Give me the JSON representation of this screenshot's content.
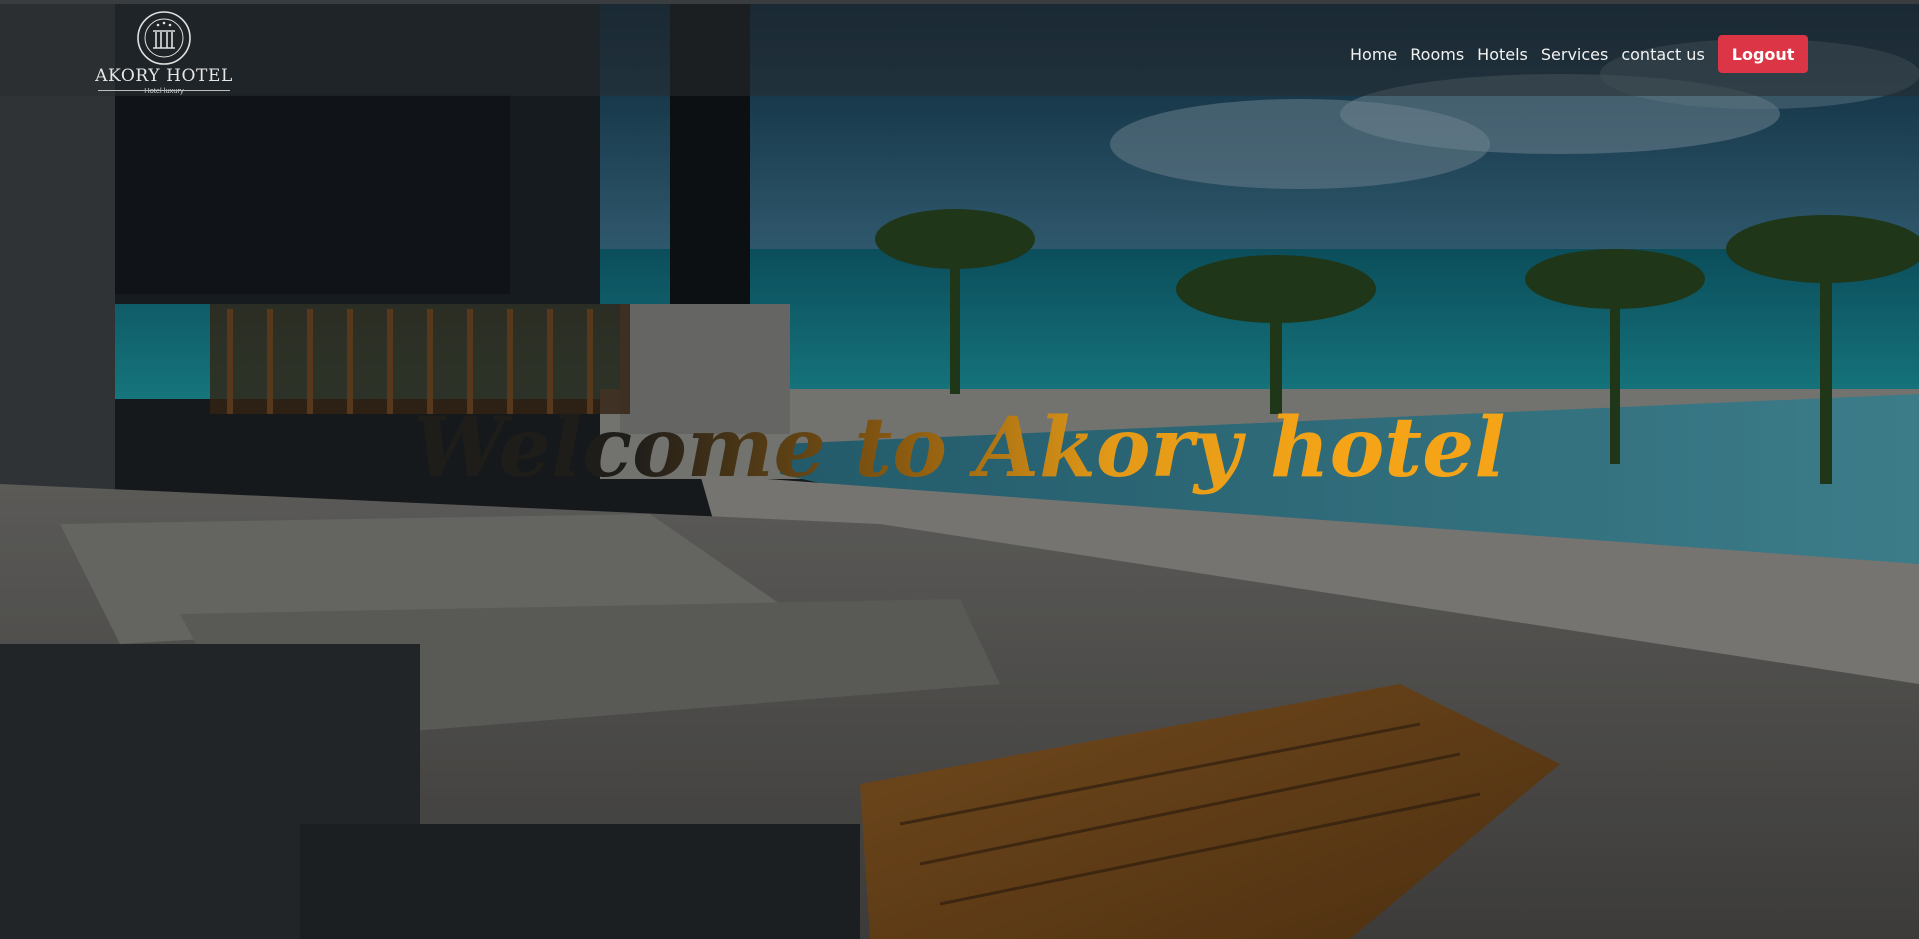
{
  "brand": {
    "name": "AKORY HOTEL",
    "tagline": "Hotel luxury",
    "icon": "hotel-crest-icon"
  },
  "nav": {
    "items": [
      {
        "label": "Home"
      },
      {
        "label": "Rooms"
      },
      {
        "label": "Hotels"
      },
      {
        "label": "Services"
      },
      {
        "label": "contact us"
      }
    ],
    "logout_label": "Logout"
  },
  "hero": {
    "title": "Welcome to Akory hotel",
    "background": "beach-resort-terrace-photo"
  },
  "colors": {
    "accent": "#f5a417",
    "logout": "#dc3545",
    "navbar": "#2b2f33"
  }
}
